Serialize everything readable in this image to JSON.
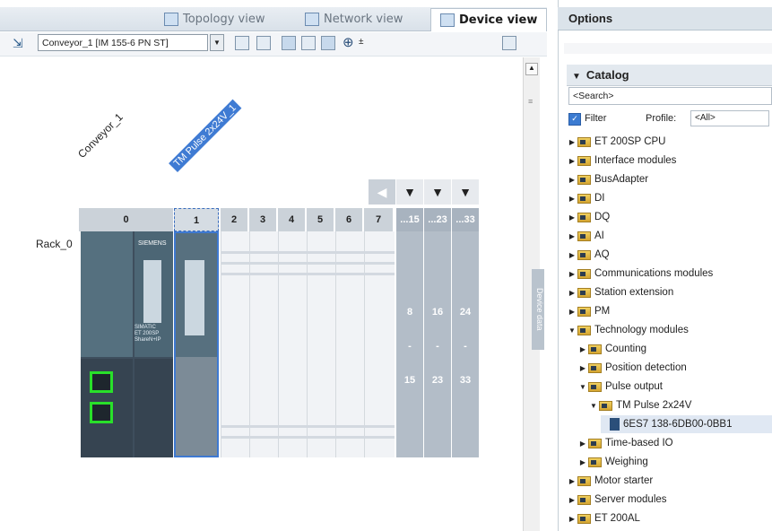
{
  "tabs": [
    {
      "label": "Topology view",
      "icon": "topology-icon"
    },
    {
      "label": "Network view",
      "icon": "network-icon"
    },
    {
      "label": "Device view",
      "icon": "device-icon"
    }
  ],
  "toolbar": {
    "device_select": "Conveyor_1 [IM 155-6 PN ST]"
  },
  "rack": {
    "name": "Rack_0",
    "station_label": "Conveyor_1",
    "module_label": "TM Pulse 2x24V_1",
    "slots": [
      "0",
      "1",
      "2",
      "3",
      "4",
      "5",
      "6",
      "7"
    ],
    "ext_heads": [
      "...15",
      "...23",
      "...33"
    ],
    "ext_top": [
      "8",
      "16",
      "24"
    ],
    "ext_mid": [
      "-",
      "-",
      "-"
    ],
    "ext_bot": [
      "15",
      "23",
      "33"
    ],
    "module_brand": "SIEMENS",
    "module_text": [
      "SIMATIC",
      "ET 200SP",
      "ShareN+IP"
    ]
  },
  "side_tab": "Device data",
  "options_title": "Options",
  "catalog": {
    "title": "Catalog",
    "search_placeholder": "<Search>",
    "filter_label": "Filter",
    "profile_label": "Profile:",
    "profile_value": "<All>",
    "items": [
      {
        "label": "ET 200SP CPU",
        "level": 0,
        "state": "closed"
      },
      {
        "label": "Interface modules",
        "level": 0,
        "state": "closed"
      },
      {
        "label": "BusAdapter",
        "level": 0,
        "state": "closed"
      },
      {
        "label": "DI",
        "level": 0,
        "state": "closed"
      },
      {
        "label": "DQ",
        "level": 0,
        "state": "closed"
      },
      {
        "label": "AI",
        "level": 0,
        "state": "closed"
      },
      {
        "label": "AQ",
        "level": 0,
        "state": "closed"
      },
      {
        "label": "Communications modules",
        "level": 0,
        "state": "closed"
      },
      {
        "label": "Station extension",
        "level": 0,
        "state": "closed"
      },
      {
        "label": "PM",
        "level": 0,
        "state": "closed"
      },
      {
        "label": "Technology modules",
        "level": 0,
        "state": "open"
      },
      {
        "label": "Counting",
        "level": 1,
        "state": "closed"
      },
      {
        "label": "Position detection",
        "level": 1,
        "state": "closed"
      },
      {
        "label": "Pulse output",
        "level": 1,
        "state": "open"
      },
      {
        "label": "TM Pulse 2x24V",
        "level": 2,
        "state": "open"
      },
      {
        "label": "6ES7 138-6DB00-0BB1",
        "level": 3,
        "state": "leaf"
      },
      {
        "label": "Time-based IO",
        "level": 1,
        "state": "closed"
      },
      {
        "label": "Weighing",
        "level": 1,
        "state": "closed"
      },
      {
        "label": "Motor starter",
        "level": 0,
        "state": "closed"
      },
      {
        "label": "Server modules",
        "level": 0,
        "state": "closed"
      },
      {
        "label": "ET 200AL",
        "level": 0,
        "state": "closed"
      }
    ]
  }
}
